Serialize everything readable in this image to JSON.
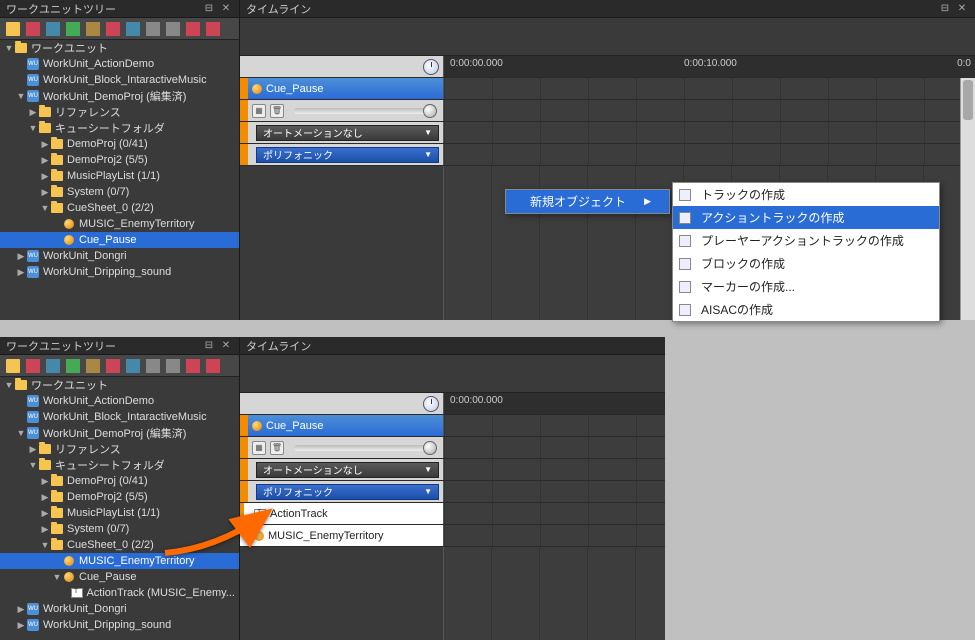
{
  "panels": {
    "tree_title": "ワークユニットツリー",
    "timeline_title": "タイムライン"
  },
  "tree_top": {
    "root": "ワークユニット",
    "items": [
      {
        "label": "WorkUnit_ActionDemo",
        "type": "wu",
        "indent": 1,
        "exp": ""
      },
      {
        "label": "WorkUnit_Block_IntaractiveMusic",
        "type": "wu",
        "indent": 1,
        "exp": ""
      },
      {
        "label": "WorkUnit_DemoProj (編集済)",
        "type": "wu",
        "indent": 1,
        "exp": "▼"
      },
      {
        "label": "リファレンス",
        "type": "folder",
        "indent": 2,
        "exp": "▶"
      },
      {
        "label": "キューシートフォルダ",
        "type": "folder",
        "indent": 2,
        "exp": "▼"
      },
      {
        "label": "DemoProj (0/41)",
        "type": "folder",
        "indent": 3,
        "exp": "▶"
      },
      {
        "label": "DemoProj2 (5/5)",
        "type": "folder",
        "indent": 3,
        "exp": "▶"
      },
      {
        "label": "MusicPlayList (1/1)",
        "type": "folder",
        "indent": 3,
        "exp": "▶"
      },
      {
        "label": "System (0/7)",
        "type": "folder",
        "indent": 3,
        "exp": "▶"
      },
      {
        "label": "CueSheet_0 (2/2)",
        "type": "folder",
        "indent": 3,
        "exp": "▼"
      },
      {
        "label": "MUSIC_EnemyTerritory",
        "type": "cue",
        "indent": 4,
        "exp": ""
      },
      {
        "label": "Cue_Pause",
        "type": "cue",
        "indent": 4,
        "exp": "",
        "selected": true
      },
      {
        "label": "WorkUnit_Dongri",
        "type": "wu",
        "indent": 1,
        "exp": "▶"
      },
      {
        "label": "WorkUnit_Dripping_sound",
        "type": "wu",
        "indent": 1,
        "exp": "▶"
      }
    ]
  },
  "tree_bottom": {
    "root": "ワークユニット",
    "items": [
      {
        "label": "WorkUnit_ActionDemo",
        "type": "wu",
        "indent": 1,
        "exp": ""
      },
      {
        "label": "WorkUnit_Block_IntaractiveMusic",
        "type": "wu",
        "indent": 1,
        "exp": ""
      },
      {
        "label": "WorkUnit_DemoProj (編集済)",
        "type": "wu",
        "indent": 1,
        "exp": "▼"
      },
      {
        "label": "リファレンス",
        "type": "folder",
        "indent": 2,
        "exp": "▶"
      },
      {
        "label": "キューシートフォルダ",
        "type": "folder",
        "indent": 2,
        "exp": "▼"
      },
      {
        "label": "DemoProj (0/41)",
        "type": "folder",
        "indent": 3,
        "exp": "▶"
      },
      {
        "label": "DemoProj2 (5/5)",
        "type": "folder",
        "indent": 3,
        "exp": "▶"
      },
      {
        "label": "MusicPlayList (1/1)",
        "type": "folder",
        "indent": 3,
        "exp": "▶"
      },
      {
        "label": "System (0/7)",
        "type": "folder",
        "indent": 3,
        "exp": "▶"
      },
      {
        "label": "CueSheet_0 (2/2)",
        "type": "folder",
        "indent": 3,
        "exp": "▼"
      },
      {
        "label": "MUSIC_EnemyTerritory",
        "type": "cue",
        "indent": 4,
        "exp": "",
        "selected": true
      },
      {
        "label": "Cue_Pause",
        "type": "cue",
        "indent": 4,
        "exp": "▼"
      },
      {
        "label": "ActionTrack (MUSIC_Enemy...",
        "type": "track",
        "indent": 5,
        "exp": ""
      },
      {
        "label": "WorkUnit_Dongri",
        "type": "wu",
        "indent": 1,
        "exp": "▶"
      },
      {
        "label": "WorkUnit_Dripping_sound",
        "type": "wu",
        "indent": 1,
        "exp": "▶"
      }
    ]
  },
  "timeline_top": {
    "ruler": [
      "0:00:00.000",
      "0:00:10.000",
      "0:0"
    ],
    "cue_name": "Cue_Pause",
    "automation": "オートメーションなし",
    "mode": "ポリフォニック"
  },
  "timeline_bottom": {
    "ruler": [
      "0:00:00.000"
    ],
    "cue_name": "Cue_Pause",
    "automation": "オートメーションなし",
    "mode": "ポリフォニック",
    "tracks": [
      {
        "name": "ActionTrack",
        "type": "track"
      },
      {
        "name": "MUSIC_EnemyTerritory",
        "type": "cue"
      }
    ]
  },
  "context_menu": {
    "primary": "新規オブジェクト",
    "secondary": [
      "トラックの作成",
      "アクショントラックの作成",
      "プレーヤーアクショントラックの作成",
      "ブロックの作成",
      "マーカーの作成...",
      "AISACの作成"
    ],
    "selected_index": 1
  }
}
